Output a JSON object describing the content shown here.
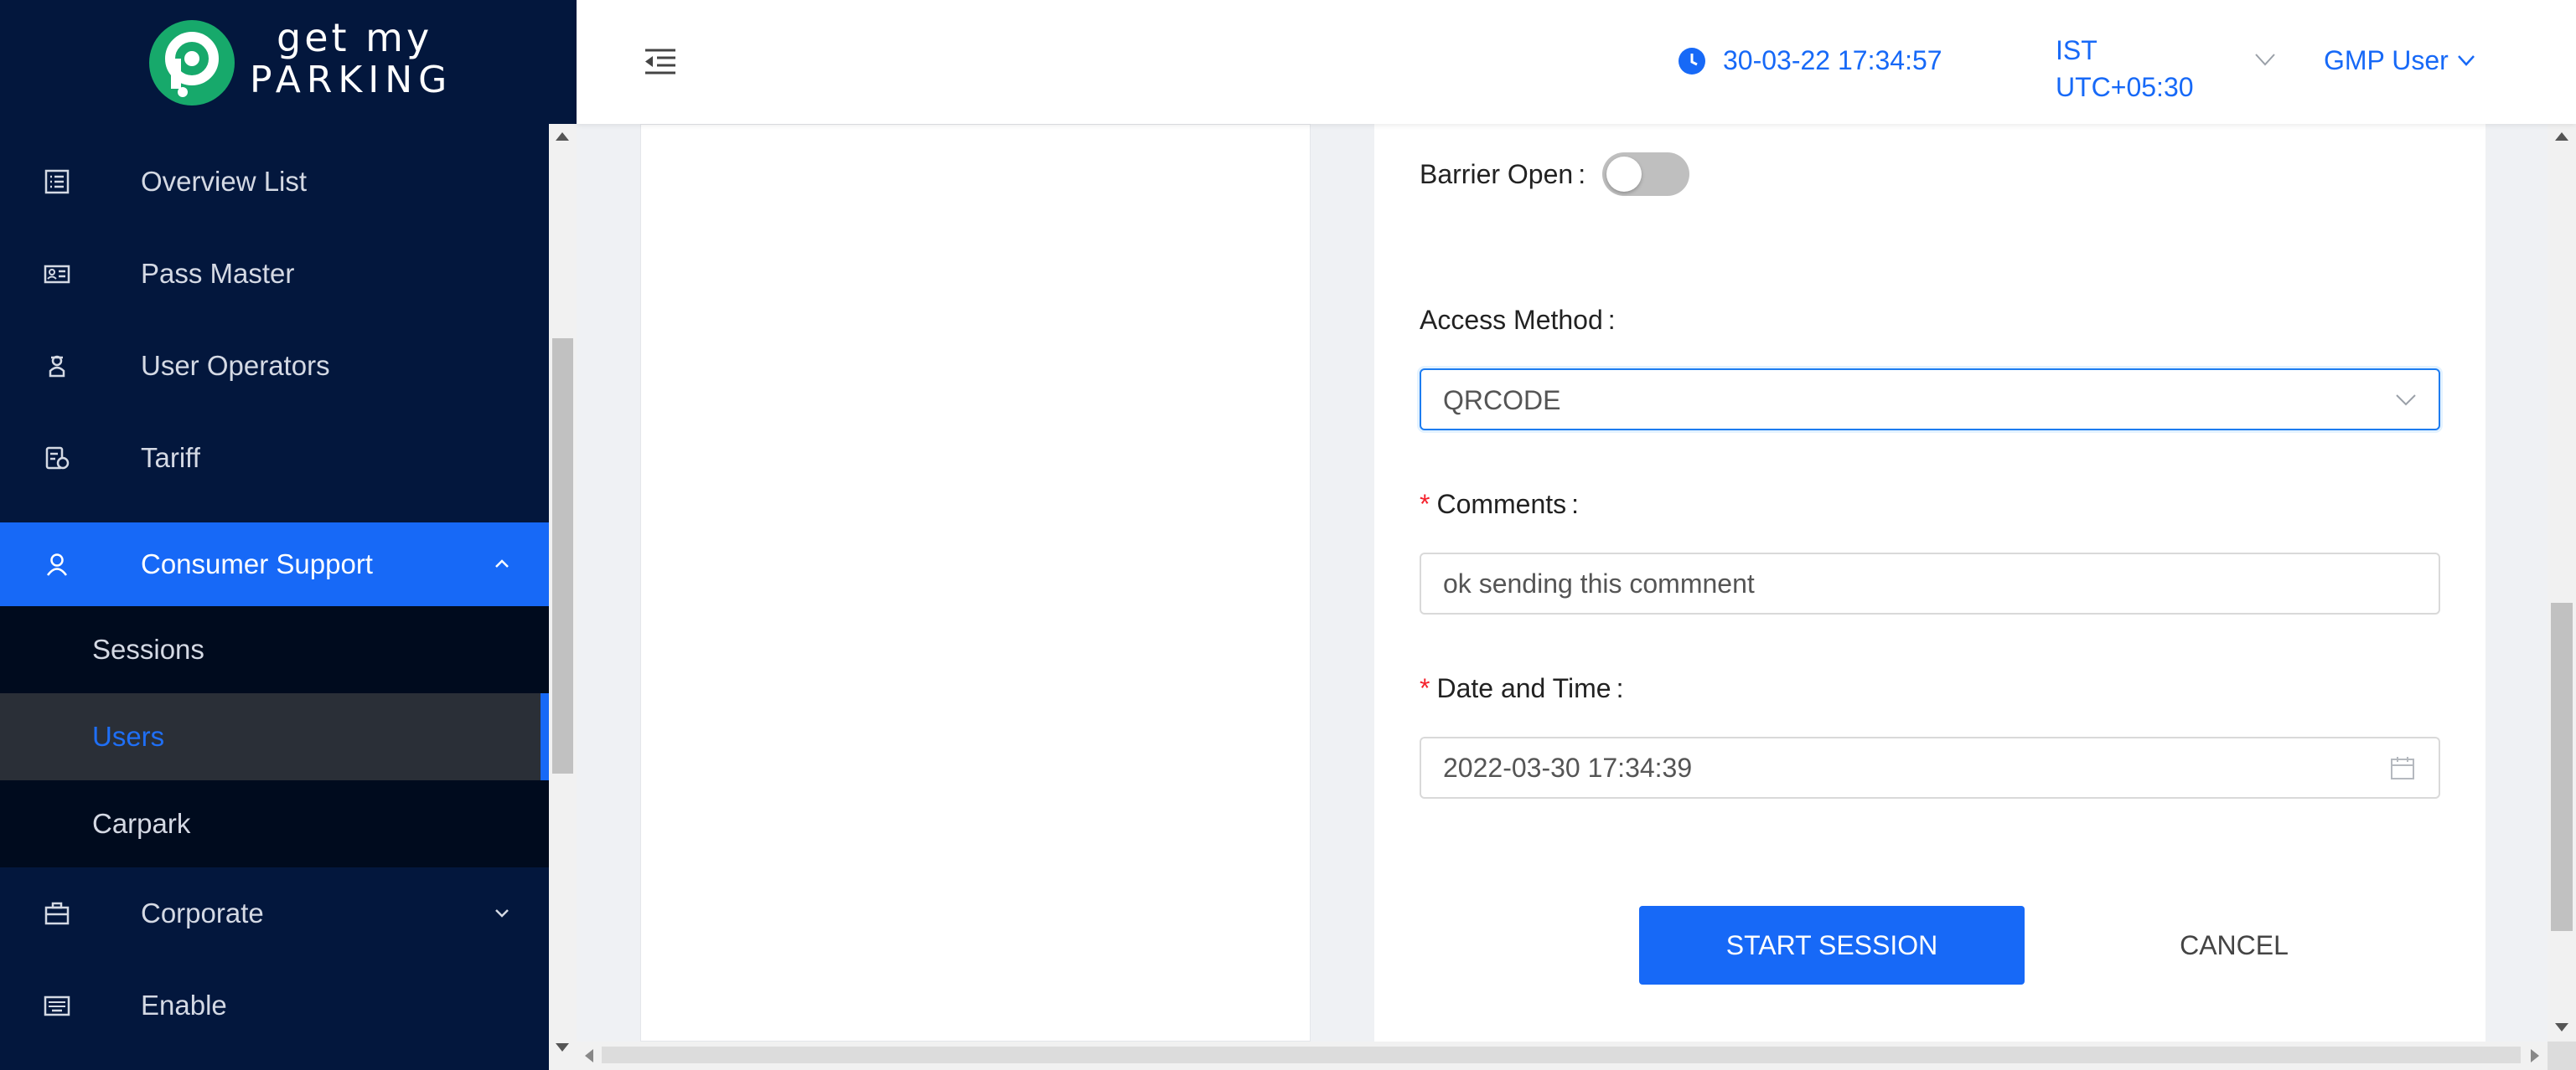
{
  "brand": {
    "line1": "get my",
    "line2": "PARKING",
    "mark_color": "#17a96b"
  },
  "colors": {
    "sidebar_bg": "#03173d",
    "accent": "#1769f7",
    "required": "#f5222d"
  },
  "sidebar": {
    "items": [
      {
        "label": "Overview List",
        "icon": "list-icon"
      },
      {
        "label": "Pass Master",
        "icon": "id-card-icon"
      },
      {
        "label": "User Operators",
        "icon": "operator-icon"
      },
      {
        "label": "Tariff",
        "icon": "tariff-icon"
      },
      {
        "label": "Consumer Support",
        "icon": "user-icon",
        "expanded": true
      },
      {
        "label": "Corporate",
        "icon": "briefcase-icon"
      },
      {
        "label": "Enable",
        "icon": "keyboard-icon"
      }
    ],
    "sub_items": [
      {
        "label": "Sessions"
      },
      {
        "label": "Users",
        "selected": true
      },
      {
        "label": "Carpark"
      }
    ]
  },
  "header": {
    "menu_icon": "menu-fold-icon",
    "datetime": "30-03-22 17:34:57",
    "timezone_line1": "IST",
    "timezone_line2": "UTC+05:30",
    "user": "GMP User"
  },
  "form": {
    "barrier_open_label": "Barrier Open",
    "barrier_open_value": false,
    "access_method_label": "Access Method",
    "access_method_value": "QRCODE",
    "comments_label": "Comments",
    "comments_value": "ok sending this commnent",
    "datetime_label": "Date and Time",
    "datetime_value": "2022-03-30 17:34:39",
    "colon": ":",
    "required_mark": "*",
    "start_button": "START SESSION",
    "cancel_button": "CANCEL"
  }
}
